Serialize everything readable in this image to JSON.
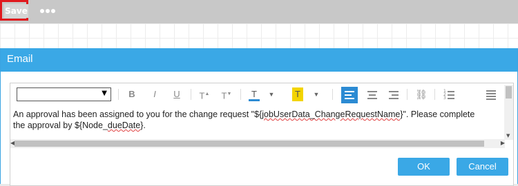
{
  "toolbar": {
    "save_label": "Save"
  },
  "dialog": {
    "title": "Email",
    "ok_label": "OK",
    "cancel_label": "Cancel"
  },
  "editor": {
    "font_select_value": "",
    "text_line1_a": "An approval has been assigned to you for the change request \"${",
    "text_line1_var": "jobUserData_ChangeRequestName",
    "text_line1_b": "}\". Please complete",
    "text_line2_a": "the approval by ${Node_",
    "text_line2_var": "dueDate",
    "text_line2_b": "}."
  },
  "colors": {
    "accent": "#3aa8e6",
    "active_tool": "#2c8bd3",
    "highlight": "#f3d400",
    "save_border": "#e0191e"
  }
}
